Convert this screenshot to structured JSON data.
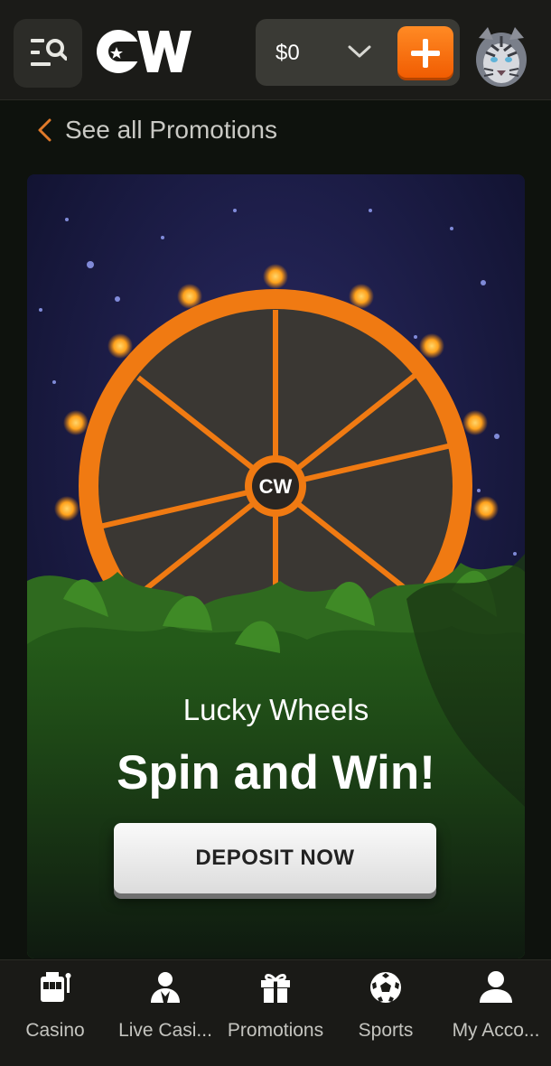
{
  "header": {
    "menu_icon": "menu-search-icon",
    "logo_text": "CW",
    "balance": "$0",
    "balance_dropdown_icon": "chevron-down-icon",
    "deposit_icon": "plus-icon",
    "avatar_icon": "tiger-avatar"
  },
  "back_link": {
    "label": "See all Promotions",
    "icon": "chevron-left-icon"
  },
  "promo": {
    "wheel_logo": "CW",
    "subtitle": "Lucky Wheels",
    "title": "Spin and Win!",
    "cta": "DEPOSIT NOW"
  },
  "nav": {
    "items": [
      {
        "label": "Casino",
        "icon": "slot-machine-icon"
      },
      {
        "label": "Live Casi...",
        "icon": "dealer-icon"
      },
      {
        "label": "Promotions",
        "icon": "gift-icon"
      },
      {
        "label": "Sports",
        "icon": "soccer-ball-icon"
      },
      {
        "label": "My Acco...",
        "icon": "user-icon"
      }
    ]
  },
  "colors": {
    "accent": "#f07a12",
    "header_bg": "#1b1b18",
    "nav_bg": "#1a1a17"
  }
}
